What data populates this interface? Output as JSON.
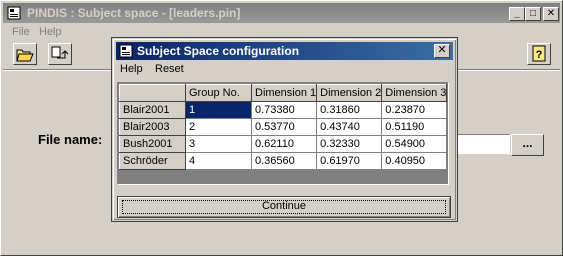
{
  "app": {
    "title": "PINDIS : Subject space - [leaders.pin]",
    "menu": [
      "File",
      "Help"
    ],
    "file_label": "File name:",
    "browse_label": "...",
    "min_label": "_",
    "max_label": "□",
    "close_label": "✕"
  },
  "dialog": {
    "title": "Subject Space configuration",
    "close_label": "✕",
    "menu": [
      "Help",
      "Reset"
    ],
    "columns": [
      "",
      "Group No.",
      "Dimension 1",
      "Dimension 2",
      "Dimension 3"
    ],
    "rows": [
      [
        "Blair2001",
        "1",
        "0.73380",
        "0.31860",
        "0.23870"
      ],
      [
        "Blair2003",
        "2",
        "0.53770",
        "0.43740",
        "0.51190"
      ],
      [
        "Bush2001",
        "3",
        "0.62110",
        "0.32330",
        "0.54900"
      ],
      [
        "Schröder",
        "4",
        "0.36560",
        "0.61970",
        "0.40950"
      ]
    ],
    "continue_label": "Continue"
  },
  "colors": {
    "dialog_title": "#0a246a",
    "selection": "#0a246a",
    "inactive_title": "#808080"
  }
}
